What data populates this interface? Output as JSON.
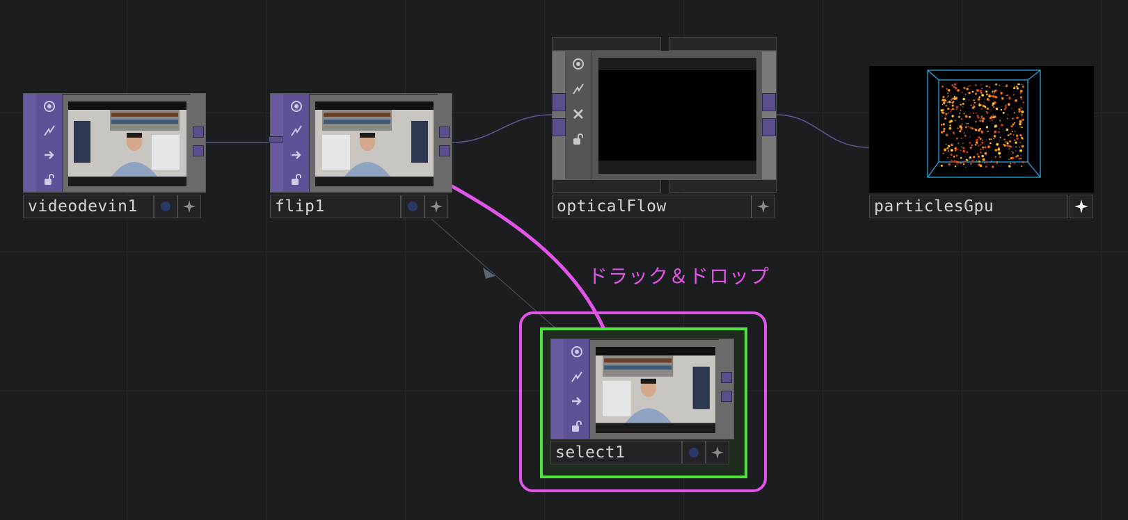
{
  "colors": {
    "background": "#1c1d1f",
    "node_strip": "#6a5aa0",
    "connector": "#5a4f8c",
    "annotation": "#e055e8",
    "highlight_green": "#4fe43c",
    "wire": "#5b5a96"
  },
  "nodes": {
    "videodevin1": {
      "label": "videodevin1",
      "preview": "webcam-person-at-desk"
    },
    "flip1": {
      "label": "flip1",
      "preview": "webcam-person-at-desk-flipped"
    },
    "opticalflow": {
      "label": "opticalFlow",
      "preview": "black-frame"
    },
    "particlesgpu": {
      "label": "particlesGpu",
      "preview": "orange-particles-in-wireframe-box"
    },
    "select1": {
      "label": "select1",
      "preview": "webcam-person-at-desk"
    }
  },
  "flag_icons": [
    "target-icon",
    "lightning-icon",
    "arrow-right-icon",
    "lock-icon"
  ],
  "annotation": {
    "text": "ドラック＆ドロップ"
  }
}
